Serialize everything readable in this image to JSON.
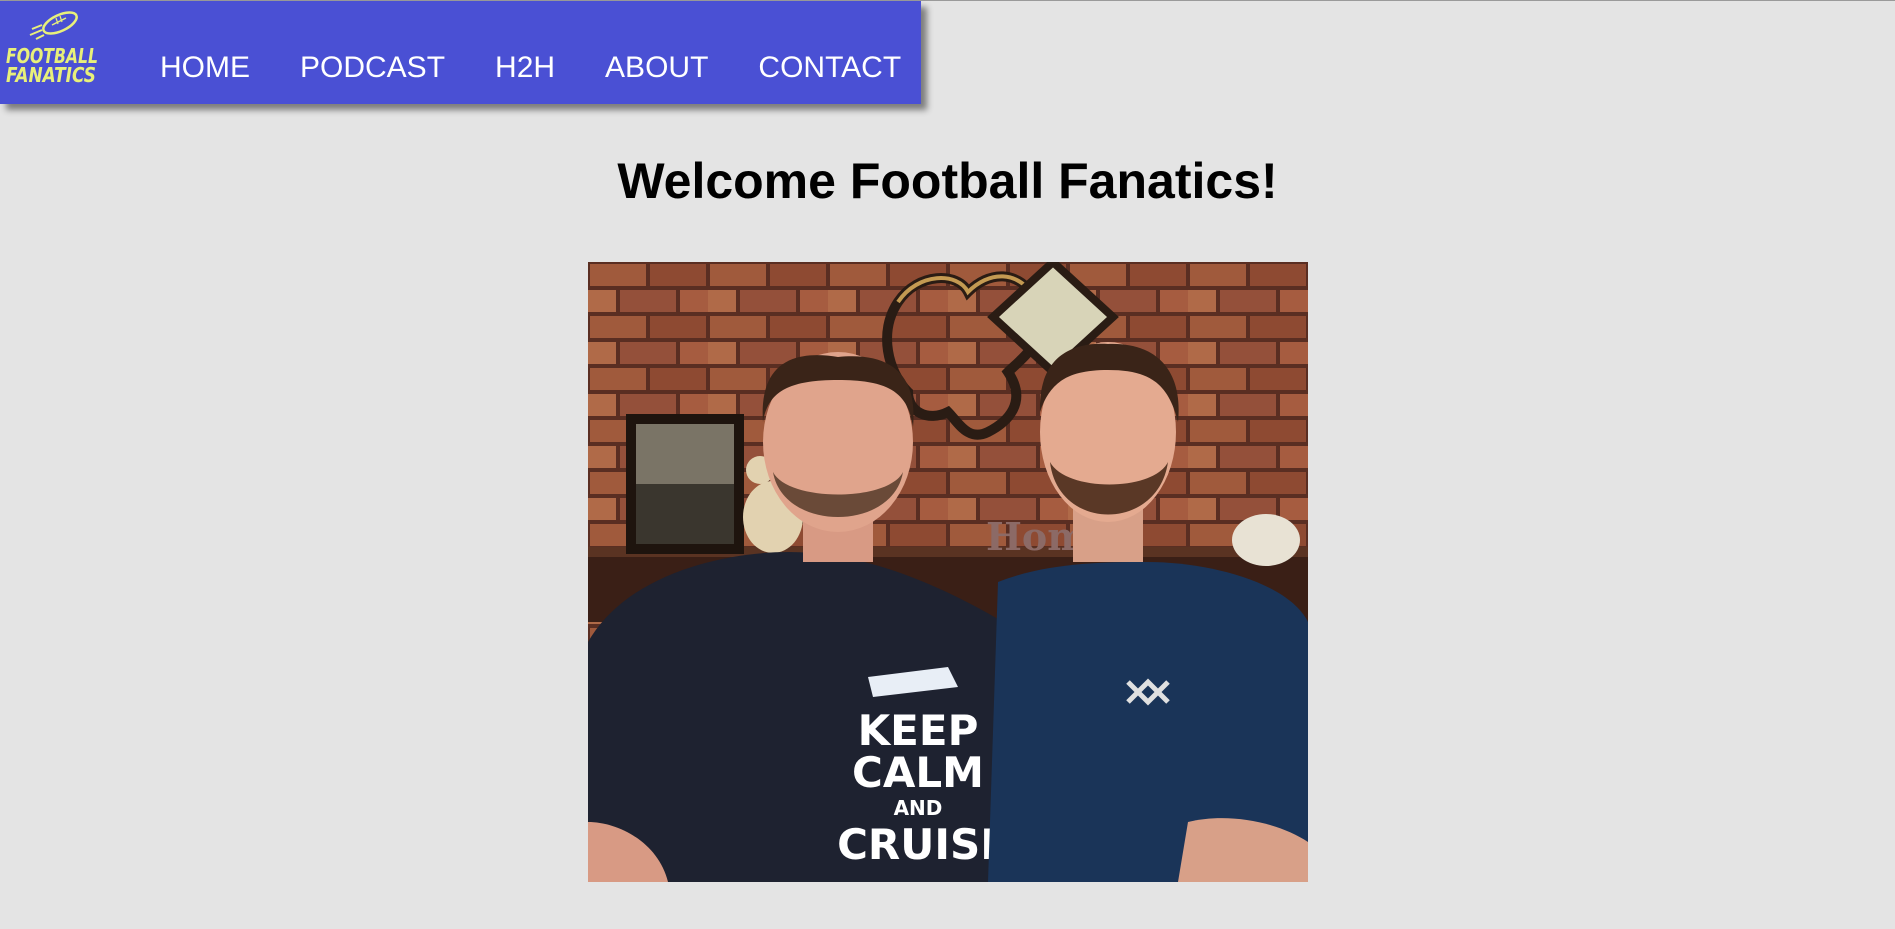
{
  "brand": {
    "logo_line1": "FOOTBALL",
    "logo_line2": "FANATICS",
    "logo_color": "#e8f07a"
  },
  "nav": {
    "background": "#4a50d4",
    "items": [
      {
        "label": "HOME"
      },
      {
        "label": "PODCAST"
      },
      {
        "label": "H2H"
      },
      {
        "label": "ABOUT"
      },
      {
        "label": "CONTACT"
      }
    ]
  },
  "main": {
    "title": "Welcome Football Fanatics!",
    "photo": {
      "shirt_line1": "KEEP",
      "shirt_line2": "CALM",
      "shirt_line3": "AND",
      "shirt_line4": "CRUISE",
      "sign_text": "Home"
    }
  }
}
